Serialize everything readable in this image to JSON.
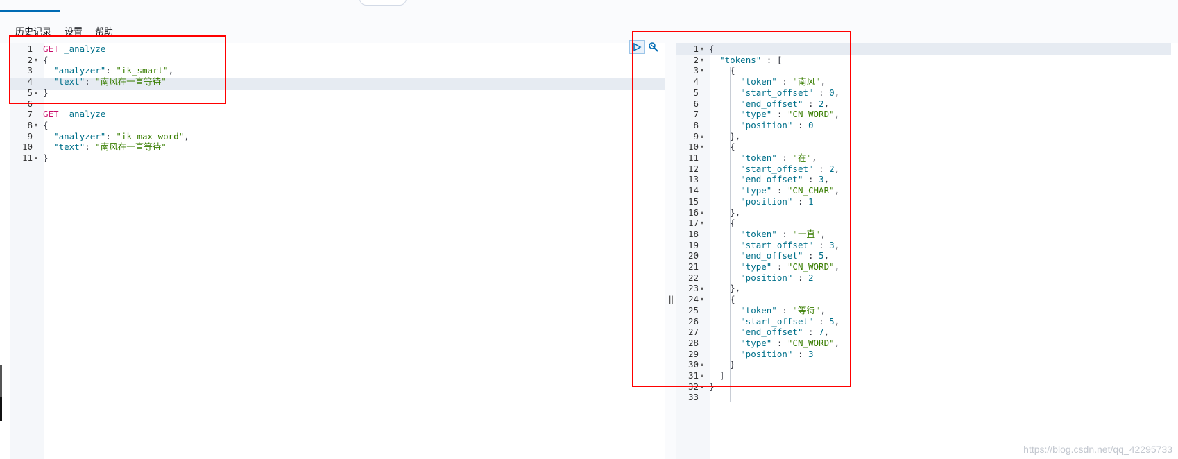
{
  "menu": {
    "history": "历史记录",
    "settings": "设置",
    "help": "帮助"
  },
  "request_editor": {
    "lines": [
      {
        "n": "1",
        "fold": "",
        "parts": [
          [
            "k-verb",
            "GET"
          ],
          [
            "k-punc",
            " "
          ],
          [
            "k-path",
            "_analyze"
          ]
        ]
      },
      {
        "n": "2",
        "fold": "▾",
        "parts": [
          [
            "k-punc",
            "{"
          ]
        ]
      },
      {
        "n": "3",
        "fold": "",
        "parts": [
          [
            "k-punc",
            "  "
          ],
          [
            "k-key",
            "\"analyzer\""
          ],
          [
            "k-punc",
            ": "
          ],
          [
            "k-str",
            "\"ik_smart\""
          ],
          [
            "k-punc",
            ","
          ]
        ]
      },
      {
        "n": "4",
        "fold": "",
        "parts": [
          [
            "k-punc",
            "  "
          ],
          [
            "k-key",
            "\"text\""
          ],
          [
            "k-punc",
            ": "
          ],
          [
            "k-str",
            "\"南风在一直等待\""
          ]
        ]
      },
      {
        "n": "5",
        "fold": "▴",
        "parts": [
          [
            "k-punc",
            "}"
          ]
        ]
      },
      {
        "n": "6",
        "fold": "",
        "parts": []
      },
      {
        "n": "7",
        "fold": "",
        "parts": [
          [
            "k-verb",
            "GET"
          ],
          [
            "k-punc",
            " "
          ],
          [
            "k-path",
            "_analyze"
          ]
        ]
      },
      {
        "n": "8",
        "fold": "▾",
        "parts": [
          [
            "k-punc",
            "{"
          ]
        ]
      },
      {
        "n": "9",
        "fold": "",
        "parts": [
          [
            "k-punc",
            "  "
          ],
          [
            "k-key",
            "\"analyzer\""
          ],
          [
            "k-punc",
            ": "
          ],
          [
            "k-str",
            "\"ik_max_word\""
          ],
          [
            "k-punc",
            ","
          ]
        ]
      },
      {
        "n": "10",
        "fold": "",
        "parts": [
          [
            "k-punc",
            "  "
          ],
          [
            "k-key",
            "\"text\""
          ],
          [
            "k-punc",
            ": "
          ],
          [
            "k-str",
            "\"南风在一直等待\""
          ]
        ]
      },
      {
        "n": "11",
        "fold": "▴",
        "parts": [
          [
            "k-punc",
            "}"
          ]
        ]
      }
    ]
  },
  "response_output": {
    "lines": [
      {
        "n": "1",
        "fold": "▾",
        "parts": [
          [
            "k-punc",
            "{"
          ]
        ]
      },
      {
        "n": "2",
        "fold": "▾",
        "parts": [
          [
            "k-punc",
            "  "
          ],
          [
            "k-key",
            "\"tokens\""
          ],
          [
            "k-punc",
            " : ["
          ]
        ]
      },
      {
        "n": "3",
        "fold": "▾",
        "parts": [
          [
            "k-punc",
            "    {"
          ]
        ]
      },
      {
        "n": "4",
        "fold": "",
        "parts": [
          [
            "k-punc",
            "      "
          ],
          [
            "k-key",
            "\"token\""
          ],
          [
            "k-punc",
            " : "
          ],
          [
            "k-str",
            "\"南风\""
          ],
          [
            "k-punc",
            ","
          ]
        ]
      },
      {
        "n": "5",
        "fold": "",
        "parts": [
          [
            "k-punc",
            "      "
          ],
          [
            "k-key",
            "\"start_offset\""
          ],
          [
            "k-punc",
            " : "
          ],
          [
            "k-num",
            "0"
          ],
          [
            "k-punc",
            ","
          ]
        ]
      },
      {
        "n": "6",
        "fold": "",
        "parts": [
          [
            "k-punc",
            "      "
          ],
          [
            "k-key",
            "\"end_offset\""
          ],
          [
            "k-punc",
            " : "
          ],
          [
            "k-num",
            "2"
          ],
          [
            "k-punc",
            ","
          ]
        ]
      },
      {
        "n": "7",
        "fold": "",
        "parts": [
          [
            "k-punc",
            "      "
          ],
          [
            "k-key",
            "\"type\""
          ],
          [
            "k-punc",
            " : "
          ],
          [
            "k-str",
            "\"CN_WORD\""
          ],
          [
            "k-punc",
            ","
          ]
        ]
      },
      {
        "n": "8",
        "fold": "",
        "parts": [
          [
            "k-punc",
            "      "
          ],
          [
            "k-key",
            "\"position\""
          ],
          [
            "k-punc",
            " : "
          ],
          [
            "k-num",
            "0"
          ]
        ]
      },
      {
        "n": "9",
        "fold": "▴",
        "parts": [
          [
            "k-punc",
            "    },"
          ]
        ]
      },
      {
        "n": "10",
        "fold": "▾",
        "parts": [
          [
            "k-punc",
            "    {"
          ]
        ]
      },
      {
        "n": "11",
        "fold": "",
        "parts": [
          [
            "k-punc",
            "      "
          ],
          [
            "k-key",
            "\"token\""
          ],
          [
            "k-punc",
            " : "
          ],
          [
            "k-str",
            "\"在\""
          ],
          [
            "k-punc",
            ","
          ]
        ]
      },
      {
        "n": "12",
        "fold": "",
        "parts": [
          [
            "k-punc",
            "      "
          ],
          [
            "k-key",
            "\"start_offset\""
          ],
          [
            "k-punc",
            " : "
          ],
          [
            "k-num",
            "2"
          ],
          [
            "k-punc",
            ","
          ]
        ]
      },
      {
        "n": "13",
        "fold": "",
        "parts": [
          [
            "k-punc",
            "      "
          ],
          [
            "k-key",
            "\"end_offset\""
          ],
          [
            "k-punc",
            " : "
          ],
          [
            "k-num",
            "3"
          ],
          [
            "k-punc",
            ","
          ]
        ]
      },
      {
        "n": "14",
        "fold": "",
        "parts": [
          [
            "k-punc",
            "      "
          ],
          [
            "k-key",
            "\"type\""
          ],
          [
            "k-punc",
            " : "
          ],
          [
            "k-str",
            "\"CN_CHAR\""
          ],
          [
            "k-punc",
            ","
          ]
        ]
      },
      {
        "n": "15",
        "fold": "",
        "parts": [
          [
            "k-punc",
            "      "
          ],
          [
            "k-key",
            "\"position\""
          ],
          [
            "k-punc",
            " : "
          ],
          [
            "k-num",
            "1"
          ]
        ]
      },
      {
        "n": "16",
        "fold": "▴",
        "parts": [
          [
            "k-punc",
            "    },"
          ]
        ]
      },
      {
        "n": "17",
        "fold": "▾",
        "parts": [
          [
            "k-punc",
            "    {"
          ]
        ]
      },
      {
        "n": "18",
        "fold": "",
        "parts": [
          [
            "k-punc",
            "      "
          ],
          [
            "k-key",
            "\"token\""
          ],
          [
            "k-punc",
            " : "
          ],
          [
            "k-str",
            "\"一直\""
          ],
          [
            "k-punc",
            ","
          ]
        ]
      },
      {
        "n": "19",
        "fold": "",
        "parts": [
          [
            "k-punc",
            "      "
          ],
          [
            "k-key",
            "\"start_offset\""
          ],
          [
            "k-punc",
            " : "
          ],
          [
            "k-num",
            "3"
          ],
          [
            "k-punc",
            ","
          ]
        ]
      },
      {
        "n": "20",
        "fold": "",
        "parts": [
          [
            "k-punc",
            "      "
          ],
          [
            "k-key",
            "\"end_offset\""
          ],
          [
            "k-punc",
            " : "
          ],
          [
            "k-num",
            "5"
          ],
          [
            "k-punc",
            ","
          ]
        ]
      },
      {
        "n": "21",
        "fold": "",
        "parts": [
          [
            "k-punc",
            "      "
          ],
          [
            "k-key",
            "\"type\""
          ],
          [
            "k-punc",
            " : "
          ],
          [
            "k-str",
            "\"CN_WORD\""
          ],
          [
            "k-punc",
            ","
          ]
        ]
      },
      {
        "n": "22",
        "fold": "",
        "parts": [
          [
            "k-punc",
            "      "
          ],
          [
            "k-key",
            "\"position\""
          ],
          [
            "k-punc",
            " : "
          ],
          [
            "k-num",
            "2"
          ]
        ]
      },
      {
        "n": "23",
        "fold": "▴",
        "parts": [
          [
            "k-punc",
            "    },"
          ]
        ]
      },
      {
        "n": "24",
        "fold": "▾",
        "parts": [
          [
            "k-punc",
            "    {"
          ]
        ]
      },
      {
        "n": "25",
        "fold": "",
        "parts": [
          [
            "k-punc",
            "      "
          ],
          [
            "k-key",
            "\"token\""
          ],
          [
            "k-punc",
            " : "
          ],
          [
            "k-str",
            "\"等待\""
          ],
          [
            "k-punc",
            ","
          ]
        ]
      },
      {
        "n": "26",
        "fold": "",
        "parts": [
          [
            "k-punc",
            "      "
          ],
          [
            "k-key",
            "\"start_offset\""
          ],
          [
            "k-punc",
            " : "
          ],
          [
            "k-num",
            "5"
          ],
          [
            "k-punc",
            ","
          ]
        ]
      },
      {
        "n": "27",
        "fold": "",
        "parts": [
          [
            "k-punc",
            "      "
          ],
          [
            "k-key",
            "\"end_offset\""
          ],
          [
            "k-punc",
            " : "
          ],
          [
            "k-num",
            "7"
          ],
          [
            "k-punc",
            ","
          ]
        ]
      },
      {
        "n": "28",
        "fold": "",
        "parts": [
          [
            "k-punc",
            "      "
          ],
          [
            "k-key",
            "\"type\""
          ],
          [
            "k-punc",
            " : "
          ],
          [
            "k-str",
            "\"CN_WORD\""
          ],
          [
            "k-punc",
            ","
          ]
        ]
      },
      {
        "n": "29",
        "fold": "",
        "parts": [
          [
            "k-punc",
            "      "
          ],
          [
            "k-key",
            "\"position\""
          ],
          [
            "k-punc",
            " : "
          ],
          [
            "k-num",
            "3"
          ]
        ]
      },
      {
        "n": "30",
        "fold": "▴",
        "parts": [
          [
            "k-punc",
            "    }"
          ]
        ]
      },
      {
        "n": "31",
        "fold": "▴",
        "parts": [
          [
            "k-punc",
            "  ]"
          ]
        ]
      },
      {
        "n": "32",
        "fold": "▴",
        "parts": [
          [
            "k-punc",
            "}"
          ]
        ]
      },
      {
        "n": "33",
        "fold": "",
        "parts": []
      }
    ]
  },
  "watermark": "https://blog.csdn.net/qq_42295733"
}
